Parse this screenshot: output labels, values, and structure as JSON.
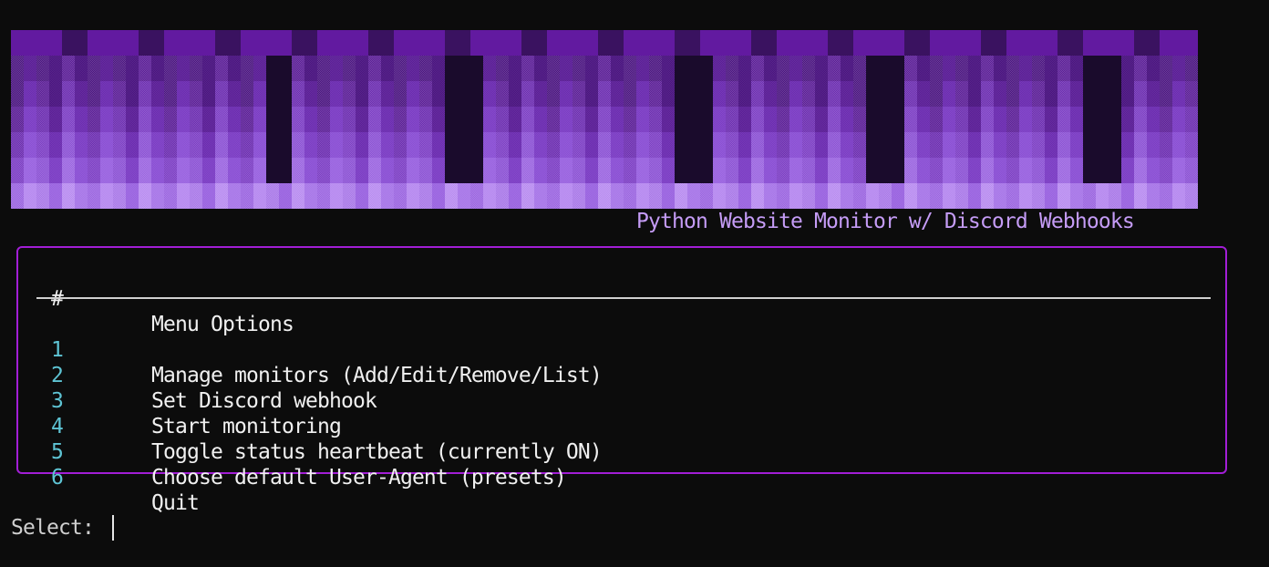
{
  "banner": {
    "palette": [
      "#4a1480",
      "#5a1d96",
      "#6b2bb0",
      "#7b3cc4",
      "#8a4fd4",
      "#9a63e0",
      "#a877e8",
      "#b78af0"
    ],
    "header_color": "#621aa0"
  },
  "subtitle": "Python Website Monitor w/ Discord Webhooks",
  "menu": {
    "border_color": "#a21ed6",
    "header": {
      "num": "#",
      "label": "Menu Options"
    },
    "items": [
      {
        "num": "1",
        "label": "Manage monitors (Add/Edit/Remove/List)"
      },
      {
        "num": "2",
        "label": "Set Discord webhook"
      },
      {
        "num": "3",
        "label": "Start monitoring"
      },
      {
        "num": "4",
        "label": "Toggle status heartbeat (currently ON)"
      },
      {
        "num": "5",
        "label": "Choose default User-Agent (presets)"
      },
      {
        "num": "6",
        "label": "Quit"
      }
    ]
  },
  "prompt": {
    "label": "Select:",
    "value": ""
  }
}
